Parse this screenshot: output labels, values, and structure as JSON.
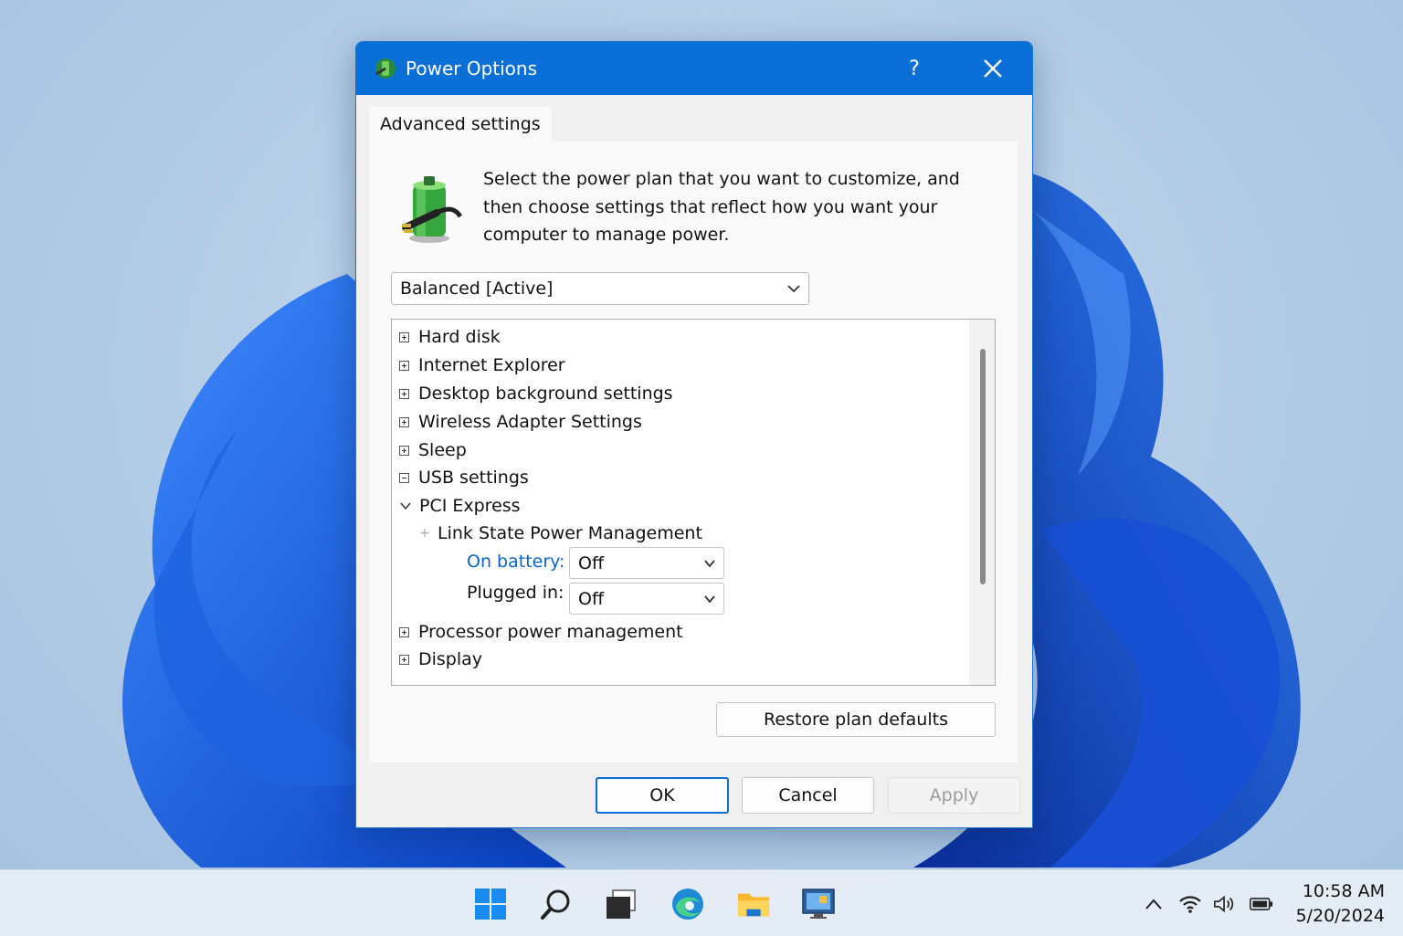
{
  "window": {
    "title": "Power Options",
    "help_label": "?"
  },
  "tab": {
    "label": "Advanced settings"
  },
  "description": "Select the power plan that you want to customize, and then choose settings that reflect how you want your computer to manage power.",
  "plan_select": {
    "value": "Balanced [Active]"
  },
  "tree": {
    "items": [
      {
        "label": "Hard disk",
        "state": "collapsed"
      },
      {
        "label": "Internet Explorer",
        "state": "collapsed"
      },
      {
        "label": "Desktop background settings",
        "state": "collapsed"
      },
      {
        "label": "Wireless Adapter Settings",
        "state": "collapsed"
      },
      {
        "label": "Sleep",
        "state": "collapsed"
      },
      {
        "label": "USB settings",
        "state": "expanded-box"
      },
      {
        "label": "PCI Express",
        "state": "expanded"
      },
      {
        "label": "Link State Power Management",
        "state": "child"
      },
      {
        "label": "Processor power management",
        "state": "collapsed"
      },
      {
        "label": "Display",
        "state": "collapsed"
      }
    ],
    "on_battery_label": "On battery:",
    "on_battery_value": "Off",
    "plugged_in_label": "Plugged in:",
    "plugged_in_value": "Off"
  },
  "buttons": {
    "restore": "Restore plan defaults",
    "ok": "OK",
    "cancel": "Cancel",
    "apply": "Apply"
  },
  "taskbar": {
    "time": "10:58 AM",
    "date": "5/20/2024"
  },
  "colors": {
    "accent": "#0a6fd6",
    "link": "#0a63c4"
  }
}
